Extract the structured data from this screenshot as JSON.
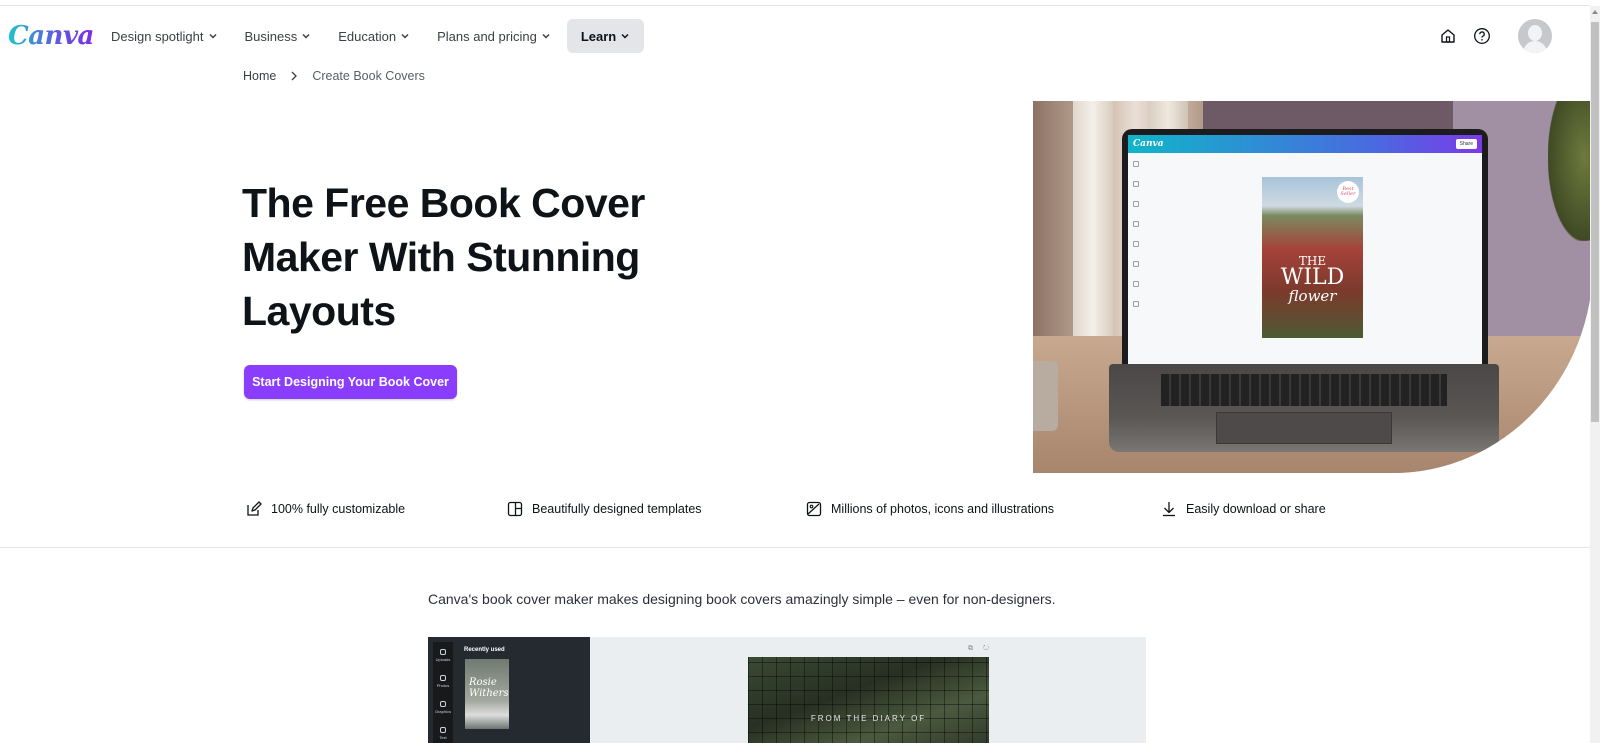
{
  "brand": {
    "logo_text": "Canva",
    "accent_color": "#8b3dff"
  },
  "nav": {
    "items": [
      {
        "label": "Design spotlight",
        "has_dropdown": true,
        "active": false
      },
      {
        "label": "Business",
        "has_dropdown": true,
        "active": false
      },
      {
        "label": "Education",
        "has_dropdown": true,
        "active": false
      },
      {
        "label": "Plans and pricing",
        "has_dropdown": true,
        "active": false
      },
      {
        "label": "Learn",
        "has_dropdown": true,
        "active": true
      }
    ],
    "right_icons": [
      "home-icon",
      "help-icon",
      "avatar"
    ]
  },
  "breadcrumb": {
    "home": "Home",
    "current": "Create Book Covers"
  },
  "hero": {
    "title": "The Free Book Cover Maker With Stunning Layouts",
    "cta_label": "Start Designing Your Book Cover",
    "image": {
      "screen_logo": "Canva",
      "share_label": "Share",
      "book_title_line1": "THE",
      "book_title_line2": "WILD",
      "book_title_line3": "flower",
      "book_badge": "Best Seller"
    }
  },
  "features": [
    {
      "icon": "edit-icon",
      "label": "100% fully customizable"
    },
    {
      "icon": "layout-icon",
      "label": "Beautifully designed templates"
    },
    {
      "icon": "image-icon",
      "label": "Millions of photos, icons and illustrations"
    },
    {
      "icon": "download-icon",
      "label": "Easily download or share"
    }
  ],
  "intro_text": "Canva's book cover maker makes designing book covers amazingly simple – even for non-designers.",
  "editor_preview": {
    "rail_items": [
      "Uploads",
      "Photos",
      "Graphics",
      "Text"
    ],
    "recent_label": "Recently used",
    "thumb_text": "Rosie Withers",
    "canvas_caption": "FROM THE DIARY OF"
  }
}
